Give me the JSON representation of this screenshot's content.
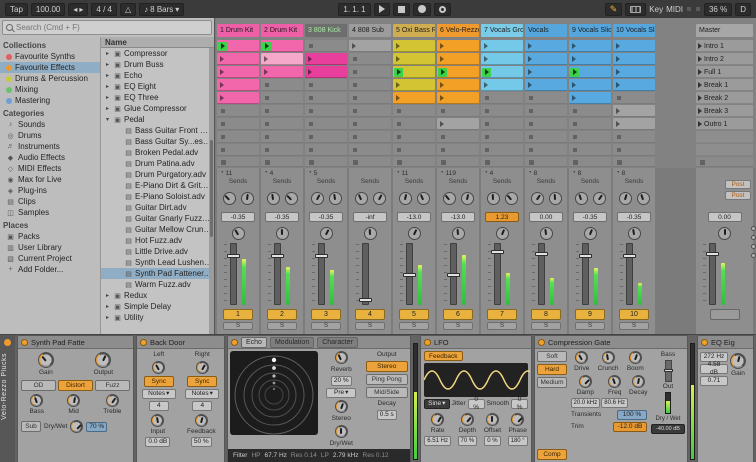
{
  "icons": {
    "metronome": "△",
    "note": "♪",
    "dropdown": "▾",
    "pie": "◔",
    "expand": "▸",
    "collapse": "▾"
  },
  "topbar": {
    "tap": "Tap",
    "tempo": "100.00",
    "time_sig": "4 / 4",
    "quantize": "8 Bars",
    "position": "1. 1. 1",
    "key_label": "Key",
    "midi_label": "MIDI",
    "cpu": "36 %",
    "disk": "D"
  },
  "browser": {
    "search_placeholder": "Search (Cmd + F)",
    "list_header": "Name",
    "sections": [
      {
        "title": "Collections",
        "items": [
          {
            "label": "Favourite Synths",
            "dot": "#e06060"
          },
          {
            "label": "Favourite Effects",
            "dot": "#e89a30",
            "selected": true
          },
          {
            "label": "Drums & Percussion",
            "dot": "#c9c93e"
          },
          {
            "label": "Mixing",
            "dot": "#6cbf6c"
          },
          {
            "label": "Mastering",
            "dot": "#6f9fd9"
          }
        ]
      },
      {
        "title": "Categories",
        "items": [
          {
            "label": "Sounds",
            "glyph": "♪"
          },
          {
            "label": "Drums",
            "glyph": "◎"
          },
          {
            "label": "Instruments",
            "glyph": "♬"
          },
          {
            "label": "Audio Effects",
            "glyph": "◆"
          },
          {
            "label": "MIDI Effects",
            "glyph": "◇"
          },
          {
            "label": "Max for Live",
            "glyph": "◉"
          },
          {
            "label": "Plug-ins",
            "glyph": "◈"
          },
          {
            "label": "Clips",
            "glyph": "▤"
          },
          {
            "label": "Samples",
            "glyph": "◫"
          }
        ]
      },
      {
        "title": "Places",
        "items": [
          {
            "label": "Packs",
            "glyph": "▣"
          },
          {
            "label": "User Library",
            "glyph": "▥"
          },
          {
            "label": "Current Project",
            "glyph": "▧"
          },
          {
            "label": "Add Folder...",
            "glyph": "+"
          }
        ]
      }
    ],
    "list": [
      {
        "label": "Compressor",
        "type": "device"
      },
      {
        "label": "Drum Buss",
        "type": "device"
      },
      {
        "label": "Echo",
        "type": "device"
      },
      {
        "label": "EQ Eight",
        "type": "device"
      },
      {
        "label": "EQ Three",
        "type": "device"
      },
      {
        "label": "Glue Compressor",
        "type": "device"
      },
      {
        "label": "Pedal",
        "type": "device-open"
      },
      {
        "label": "Bass Guitar Front of Stage.adv",
        "type": "preset"
      },
      {
        "label": "Bass Guitar Sy...esizerizer.adv",
        "type": "preset"
      },
      {
        "label": "Broken Pedal.adv",
        "type": "preset"
      },
      {
        "label": "Drum Patina.adv",
        "type": "preset"
      },
      {
        "label": "Drum Purgatory.adv",
        "type": "preset"
      },
      {
        "label": "E-Piano Dirt & Grit.adv",
        "type": "preset"
      },
      {
        "label": "E-Piano Soloist.adv",
        "type": "preset"
      },
      {
        "label": "Guitar Dirt.adv",
        "type": "preset"
      },
      {
        "label": "Guitar Gnarly Fuzz.adv",
        "type": "preset"
      },
      {
        "label": "Guitar Mellow Crunch.adv",
        "type": "preset"
      },
      {
        "label": "Hot Fuzz.adv",
        "type": "preset"
      },
      {
        "label": "Little Drive.adv",
        "type": "preset"
      },
      {
        "label": "Synth Lead Lushener.adv",
        "type": "preset"
      },
      {
        "label": "Synth Pad Fattener.adv",
        "type": "preset",
        "selected": true
      },
      {
        "label": "Warm Fuzz.adv",
        "type": "preset"
      },
      {
        "label": "Redux",
        "type": "device"
      },
      {
        "label": "Simple Delay",
        "type": "device"
      },
      {
        "label": "Utility",
        "type": "device"
      }
    ]
  },
  "session": {
    "master_label": "Master",
    "tracks": [
      {
        "name": "1 Drum Kit",
        "color": "pink"
      },
      {
        "name": "2 Drum Kit",
        "color": "pink"
      },
      {
        "name": "3 808 Kick",
        "color": "dark"
      },
      {
        "name": "4 808 Sub",
        "color": "gray"
      },
      {
        "name": "5 Oxi Bass Rack",
        "color": "yellow"
      },
      {
        "name": "6 Velo-Rezzo P",
        "color": "orange"
      },
      {
        "name": "7 Vocals Group",
        "color": "lightblue"
      },
      {
        "name": "Vocals",
        "color": "blue"
      },
      {
        "name": "9 Vocals Slice",
        "color": "blue"
      },
      {
        "name": "10 Vocals Slice",
        "color": "blue"
      }
    ],
    "scenes": [
      "Intro 1",
      "Intro 2",
      "Full 1",
      "Break 1",
      "Break 2",
      "Break 3",
      "Outro 1"
    ],
    "clip_grid": [
      [
        "play pink",
        "play pink",
        "",
        "gray",
        "yellow",
        "orange",
        "lightblue",
        "blue",
        "blue",
        "blue"
      ],
      [
        "pink",
        "pinklight",
        "magenta",
        "",
        "yellow",
        "orange",
        "lightblue",
        "blue",
        "blue",
        "blue"
      ],
      [
        "pink",
        "pink",
        "magenta",
        "",
        "play yellow",
        "play orange",
        "play lightblue",
        "blue",
        "play blue",
        "blue"
      ],
      [
        "pink",
        "",
        "",
        "",
        "yellow",
        "orange",
        "lightblue",
        "blue",
        "blue",
        "blue"
      ],
      [
        "pink",
        "",
        "",
        "",
        "orange",
        "orange",
        "",
        "",
        "blue",
        ""
      ],
      [
        "",
        "",
        "",
        "",
        "",
        "",
        "",
        "",
        "",
        "gray"
      ],
      [
        "",
        "",
        "",
        "",
        "",
        "gray",
        "",
        "",
        "",
        "gray"
      ],
      [
        "",
        "",
        "",
        "",
        "",
        "",
        "",
        "",
        "",
        ""
      ],
      [
        "",
        "",
        "",
        "",
        "",
        "",
        "",
        "",
        "",
        ""
      ]
    ],
    "mixer": {
      "sends_label": "Sends",
      "status": [
        "11",
        "4",
        "5",
        "",
        "11",
        "119",
        "4",
        "8",
        "8",
        "8"
      ],
      "volumes": [
        "-0.35",
        "-0.35",
        "-0.35",
        "-inf",
        "-13.0",
        "-13.0",
        "1.23",
        "0.00",
        "-0.35",
        "-0.35"
      ],
      "highlight_index": 6,
      "fader_pos": [
        0.8,
        0.8,
        0.8,
        0.03,
        0.46,
        0.46,
        0.86,
        0.82,
        0.8,
        0.8
      ],
      "meters": [
        0.72,
        0.6,
        0.55,
        0.0,
        0.62,
        0.78,
        0.5,
        0.42,
        0.58,
        0.35
      ],
      "activators": [
        "1",
        "2",
        "3",
        "4",
        "5",
        "6",
        "7",
        "8",
        "9",
        "10"
      ],
      "solo_label": "S",
      "post_a": "Post",
      "post_b": "Post",
      "master_volume": "0.00"
    }
  },
  "device_chain": {
    "track_tab": "Velo-Rezzo Plucks",
    "pedal": {
      "title": "Synth Pad Fatte",
      "gain_label": "Gain",
      "output_label": "Output",
      "modes": [
        "OD",
        "Distort",
        "Fuzz"
      ],
      "active_mode": "Distort",
      "bass_label": "Bass",
      "mid_label": "Mid",
      "treble_label": "Treble",
      "sub_label": "Sub",
      "drywet_label": "Dry/Wet",
      "drywet_value": "70 %"
    },
    "back_door": {
      "title": "Back Door",
      "left_label": "Left",
      "right_label": "Right",
      "sync_label": "Sync",
      "mode_label": "Notes",
      "left_step": "4",
      "right_step": "4",
      "input_label": "Input",
      "input_value": "0.0 dB",
      "feedback_label": "Feedback",
      "feedback_value": "50 %"
    },
    "echo": {
      "tabs": [
        "Echo",
        "Modulation",
        "Character"
      ],
      "active_tab": "Echo",
      "reverb_label": "Reverb",
      "reverb_value": "20 %",
      "position_value": "Pre",
      "stereo_label": "Stereo",
      "output_label": "Output",
      "modes": [
        "Stereo",
        "Ping Pong",
        "Mid/Side"
      ],
      "active_mode": "Stereo",
      "decay_label": "Decay",
      "decay_value": "0.5 s",
      "drywet_label": "Dry/Wet",
      "filter_label": "Filter",
      "hp_label": "HP",
      "hp_freq": "67.7 Hz",
      "hp_res": "Res 0.14",
      "lp_label": "LP",
      "lp_freq": "2.79 kHz",
      "lp_res": "Res 0.12"
    },
    "lfo": {
      "title": "LFO",
      "map_chip": "Feedback",
      "wave_value": "Sine",
      "jitter_label": "Jitter",
      "jitter_value": "0 %",
      "smooth_label": "Smooth",
      "smooth_value": "0 %",
      "rate_label": "Rate",
      "rate_value": "6.51 Hz",
      "depth_label": "Depth",
      "depth_value": "70 %",
      "offset_label": "Offset",
      "offset_value": "0 %",
      "phase_label": "Phase",
      "phase_value": "180 °"
    },
    "drum_buss": {
      "title": "Compression Gate",
      "drive_label": "Drive",
      "crunch_label": "Crunch",
      "boom_label": "Boom",
      "modes": [
        "Soft",
        "Hard",
        "Medium"
      ],
      "active_mode": "Hard",
      "damp_label": "Damp",
      "damp_value": "20.0 kHz",
      "freq_label": "Freq",
      "freq_value": "80.6 Hz",
      "decay_label": "Decay",
      "transients_label": "Transients",
      "transients_value": "100 %",
      "trim_label": "Trim",
      "trim_value": "-12.0 dB",
      "comp_label": "Comp",
      "bass_label": "Bass",
      "out_label": "Out",
      "drywet_label": "Dry / Wet",
      "drywet_value": "-40.00 dB"
    },
    "eq_eight": {
      "title": "EQ Eig",
      "freq_value": "272 Hz",
      "gain_value": "4.58 dB",
      "q_value": "0.71",
      "gain_label": "Gain"
    }
  }
}
